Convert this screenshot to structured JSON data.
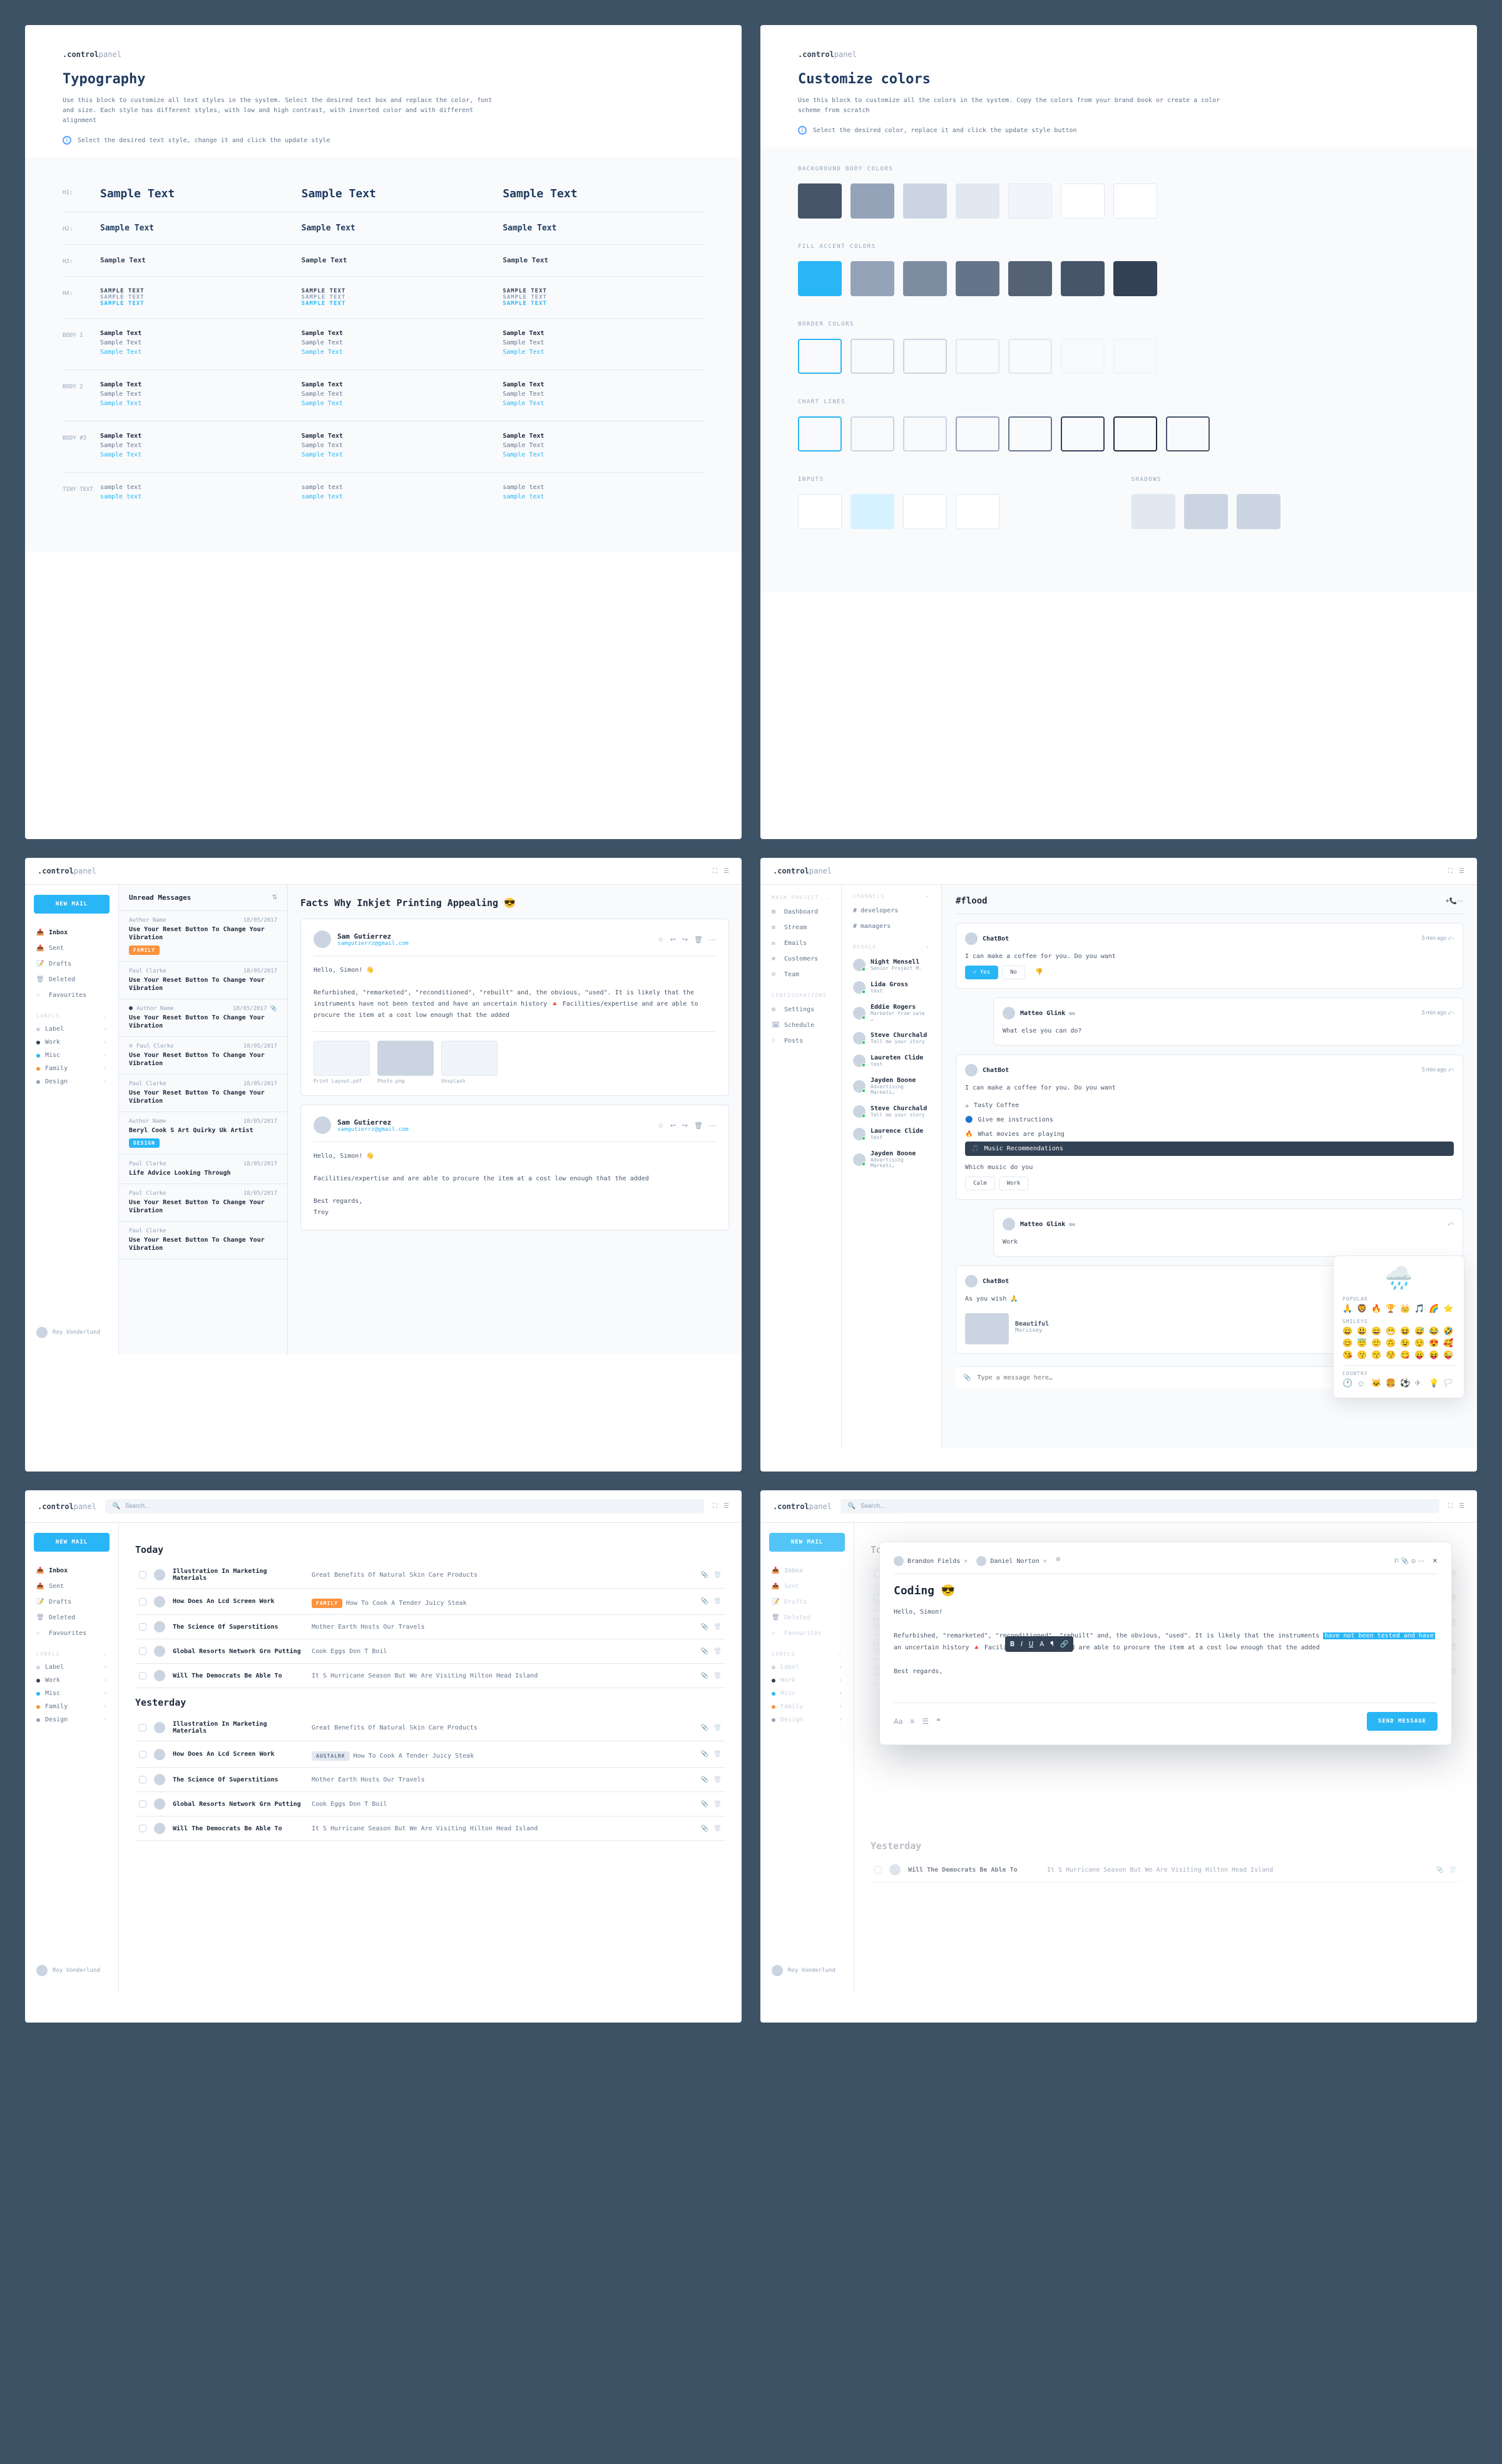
{
  "brand": {
    "a": ".control",
    "b": "panel"
  },
  "typography": {
    "title": "Typography",
    "desc": "Use this block to customize all text styles in the system. Select the desired text box and replace the color, font and size. Each style has different styles, with low and high contrast, with inverted color and with different alignment",
    "hint": "Select the desired text style, change it and click the update style",
    "sample": "Sample Text",
    "sample_upper": "SAMPLE TEXT",
    "sample_lower": "sample text",
    "labels": {
      "h1": "H1:",
      "h2": "H2:",
      "h3": "H3:",
      "h4": "H4:",
      "body1": "BODY 1",
      "body2": "BODY 2",
      "body3": "BODY #3",
      "tiny": "TINY TEXT"
    }
  },
  "colors": {
    "title": "Customize colors",
    "desc": "Use this block to customize all the colors in the system. Copy the colors from your brand book or create a color scheme from scratch",
    "hint": "Select the desired color, replace it and click the update style button",
    "sections": {
      "bg": "BACKGROUND BODY COLORS",
      "fill": "FILL ACCENT COLORS",
      "border": "BORDER COLORS",
      "chart": "CHART LINES",
      "inputs": "INPUTS",
      "shadows": "SHADOWS"
    },
    "bg": [
      "#475569",
      "#94a3b8",
      "#cbd5e1",
      "#e2e8f0",
      "#f1f5f9",
      "#ffffff",
      "#ffffff"
    ],
    "fill": [
      "#29b6f6",
      "#94a3b8",
      "#7d8da1",
      "#64748b",
      "#556274",
      "#475569",
      "#334155"
    ],
    "border": [
      "#29b6f6",
      "#cbd5e1",
      "#cbd5e1",
      "#e2e8f0",
      "#e2e8f0",
      "#f1f5f9",
      "#f1f5f9"
    ],
    "chart": [
      "#29b6f6",
      "#cbd5e1",
      "#cbd5e1",
      "#94a3b8",
      "#64748b",
      "#334155",
      "#1e293b",
      "#475569"
    ],
    "inputs": [
      "#ffffff",
      "#d6f1ff",
      "#ffffff",
      "#ffffff"
    ],
    "shadows": [
      "#e2e8f0",
      "#cbd5e1",
      "#cbd5e1"
    ]
  },
  "mail": {
    "searchPlaceholder": "Search...",
    "newMail": "NEW MAIL",
    "nav": [
      {
        "icon": "inbox",
        "label": "Inbox",
        "active": true
      },
      {
        "icon": "sent",
        "label": "Sent"
      },
      {
        "icon": "draft",
        "label": "Drafts"
      },
      {
        "icon": "trash",
        "label": "Deleted"
      },
      {
        "icon": "star",
        "label": "Favourites"
      }
    ],
    "labelsHeader": "LABELS",
    "labels": [
      {
        "name": "Label",
        "color": "#cbd5e1"
      },
      {
        "name": "Work",
        "color": "#334155"
      },
      {
        "name": "Misc",
        "color": "#29b6f6"
      },
      {
        "name": "Family",
        "color": "#fb923c"
      },
      {
        "name": "Design",
        "color": "#94a3b8"
      }
    ],
    "user": "Roy Vonderlund",
    "unreadTitle": "Unread Messages",
    "messages": [
      {
        "author": "Author Name",
        "date": "18/05/2017",
        "title": "Use Your Reset Button To Change Your Vibration",
        "tag": "FAMILY",
        "tagClass": "tag-orange"
      },
      {
        "author": "Paul Clarke",
        "date": "18/05/2017",
        "title": "Use Your Reset Button To Change Your Vibration"
      },
      {
        "author": "Author Name",
        "date": "18/05/2017",
        "title": "Use Your Reset Button To Change Your Vibration",
        "dot": "#334155",
        "clip": true
      },
      {
        "author": "Paul Clarke",
        "date": "18/05/2017",
        "title": "Use Your Reset Button To Change Your Vibration",
        "dot": "#cbd5e1"
      },
      {
        "author": "Paul Clarke",
        "date": "18/05/2017",
        "title": "Use Your Reset Button To Change Your Vibration"
      },
      {
        "author": "Author Name",
        "date": "18/05/2017",
        "title": "Beryl Cook S Art Quirky Uk Artist",
        "tag": "DESIGN",
        "tagClass": "tag-blue"
      },
      {
        "author": "Paul Clarke",
        "date": "18/05/2017",
        "title": "Life Advice Looking Through"
      },
      {
        "author": "Paul Clarke",
        "date": "18/05/2017",
        "title": "Use Your Reset Button To Change Your Vibration"
      },
      {
        "author": "Paul Clarke",
        "date": "",
        "title": "Use Your Reset Button To Change Your Vibration"
      }
    ],
    "readerTitle": "Facts Why Inkjet Printing Appealing 😎",
    "sender": {
      "name": "Sam Gutierrez",
      "email": "samgutierrz@gmail.com"
    },
    "greeting": "Hello, Simon! 👋",
    "body1": "Refurbished, \"remarketed\", \"reconditioned\", \"rebuilt\" and, the obvious, \"used\". It is likely that the instruments have not been tested and have an uncertain history 🔺 Facilities/expertise and are able to procure the item at a cost low enough that the added",
    "attachments": [
      {
        "name": "Print Layout.pdf",
        "light": true
      },
      {
        "name": "Photo.png"
      },
      {
        "name": "Unsplash",
        "light": true
      }
    ],
    "body2": "Facilities/expertise and are able to procure the item at a cost low enough that the added",
    "signoff": "Best regards,\nTroy"
  },
  "mailList": {
    "groups": [
      {
        "title": "Today",
        "rows": [
          {
            "title": "Illustration In Marketing Materials",
            "desc": "Great Benefits Of Natural Skin Care Products"
          },
          {
            "title": "How Does An Lcd Screen Work",
            "tag": "FAMILY",
            "tagClass": "tag-orange",
            "desc": "How To Cook A Tender Juicy Steak"
          },
          {
            "title": "The Science Of Superstitions",
            "desc": "Mother Earth Hosts Our Travels"
          },
          {
            "title": "Global Resorts Network Grn Putting",
            "desc": "Cook Eggs Don T Boil"
          },
          {
            "title": "Will The Democrats Be Able To",
            "desc": "It S Hurricane Season But We Are Visiting Hilton Head Island"
          }
        ]
      },
      {
        "title": "Yesterday",
        "rows": [
          {
            "title": "Illustration In Marketing Materials",
            "desc": "Great Benefits Of Natural Skin Care Products"
          },
          {
            "title": "How Does An Lcd Screen Work",
            "tag": "AUSTALRK",
            "tagClass": "tag-ghost",
            "desc": "How To Cook A Tender Juicy Steak"
          },
          {
            "title": "The Science Of Superstitions",
            "desc": "Mother Earth Hosts Our Travels"
          },
          {
            "title": "Global Resorts Network Grn Putting",
            "desc": "Cook Eggs Don T Boil"
          },
          {
            "title": "Will The Democrats Be Able To",
            "desc": "It S Hurricane Season But We Are Visiting Hilton Head Island"
          }
        ]
      }
    ]
  },
  "chat": {
    "project": "MAIN PROJECT",
    "nav": [
      {
        "i": "⊞",
        "l": "Dashboard"
      },
      {
        "i": "≡",
        "l": "Stream"
      },
      {
        "i": "✉",
        "l": "Emails"
      },
      {
        "i": "⊚",
        "l": "Customers"
      },
      {
        "i": "☺",
        "l": "Team"
      }
    ],
    "confHeader": "CONFIGURATIONS",
    "conf": [
      {
        "i": "⚙",
        "l": "Settings"
      },
      {
        "i": "🗓",
        "l": "Schedule"
      },
      {
        "i": "⚐",
        "l": "Posts"
      }
    ],
    "channelsHeader": "CHANNELS",
    "channels": [
      "# developers",
      "# managers"
    ],
    "peopleHeader": "PEOPLE",
    "people": [
      {
        "name": "Night Mensell",
        "sub": "Senior Project M."
      },
      {
        "name": "Lida Gross",
        "sub": "text"
      },
      {
        "name": "Eddie Rogers",
        "sub": "Marketer from sale …"
      },
      {
        "name": "Steve Churchald",
        "sub": "Tell me your story"
      },
      {
        "name": "Laureten Clide",
        "sub": "text"
      },
      {
        "name": "Jayden Boone",
        "sub": "Advertising Marketi…"
      },
      {
        "name": "Steve Churchald",
        "sub": "Tell me your story"
      },
      {
        "name": "Laurence Clide",
        "sub": "text"
      },
      {
        "name": "Jayden Boone",
        "sub": "Advertising Marketi…"
      }
    ],
    "channelTitle": "#flood",
    "msgs": [
      {
        "name": "ChatBot",
        "time": "5 min ago",
        "body": "I can make a coffee for you. Do you want",
        "buttons": [
          "Yes",
          "No"
        ],
        "primary": 0,
        "thumb": true
      },
      {
        "name": "Matteo Glink",
        "time": "5 min ago",
        "body": "What else you can do?",
        "me": true
      },
      {
        "name": "ChatBot",
        "time": "5 min ago",
        "body": "I can make a coffee for you. Do you want",
        "options": [
          {
            "i": "☕",
            "l": "Tasty Coffee"
          },
          {
            "i": "🔵",
            "l": "Give me instructions"
          },
          {
            "i": "🔥",
            "l": "What movies are playing"
          },
          {
            "i": "🎵",
            "l": "Music Recommendations",
            "sel": true
          }
        ],
        "question": "Which music do you",
        "postButtons": [
          "Calm",
          "Work"
        ]
      },
      {
        "name": "Matteo Glink",
        "time": "",
        "body": "Work",
        "me": true
      },
      {
        "name": "ChatBot",
        "time": "",
        "body": "As you wish 🙏",
        "attachment": {
          "title": "Beautiful",
          "artist": "Morissey"
        }
      }
    ],
    "inputPlaceholder": "Type a message here…",
    "emojiSections": {
      "popular": "POPULAR",
      "smileys": "SMILEYS",
      "country": "COUNTRY"
    }
  },
  "compose": {
    "recipients": [
      "Brandon Fields",
      "Daniel Norton"
    ],
    "subject": "Coding 😎",
    "greeting": "Hello, Simon!",
    "body": "Refurbished, \"remarketed\", \"reconditioned\", \"rebuilt\" and, the obvious, \"used\". It is likely that the instruments have not been tested and have an uncertain history 🔺 Facilities/expertise and are able to procure the item at a cost low enough that the added",
    "highlight": "have not been tested and have",
    "signoff": "Best regards,",
    "send": "SEND MESSAGE",
    "behindTitle": "Today",
    "behindYesterday": "Yesterday",
    "behindRow": {
      "title": "Will The Democrats Be Able To",
      "desc": "It S Hurricane Season But We Are Visiting Hilton Head Island"
    }
  }
}
